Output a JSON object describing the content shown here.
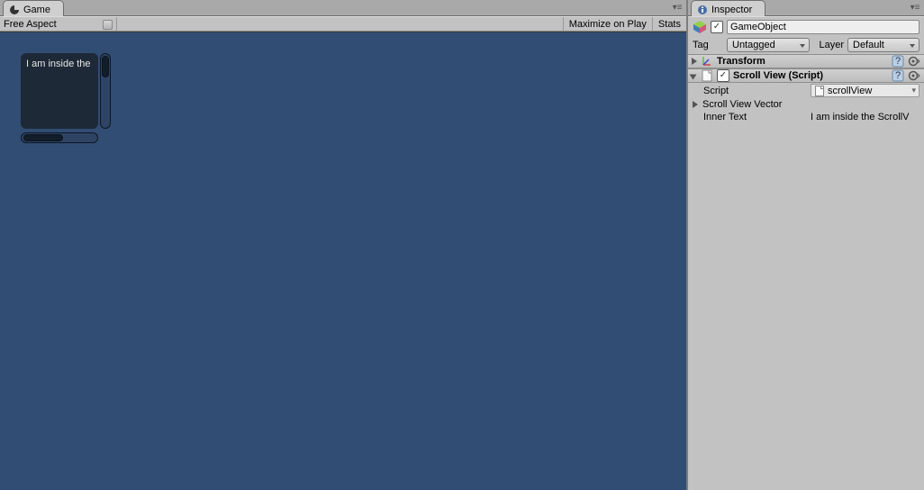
{
  "game": {
    "tab_label": "Game",
    "aspect_label": "Free Aspect",
    "maximize_label": "Maximize on Play",
    "stats_label": "Stats",
    "scroll_text": "I am inside the"
  },
  "inspector": {
    "tab_label": "Inspector",
    "gameobject": {
      "enabled": true,
      "name": "GameObject",
      "tag_label": "Tag",
      "tag_value": "Untagged",
      "layer_label": "Layer",
      "layer_value": "Default"
    },
    "components": {
      "transform": {
        "title": "Transform"
      },
      "scrollview": {
        "title": "Scroll View (Script)",
        "script_label": "Script",
        "script_value": "scrollView",
        "vector_label": "Scroll View Vector",
        "innertext_label": "Inner Text",
        "innertext_value": "I am inside the ScrollV"
      }
    }
  }
}
